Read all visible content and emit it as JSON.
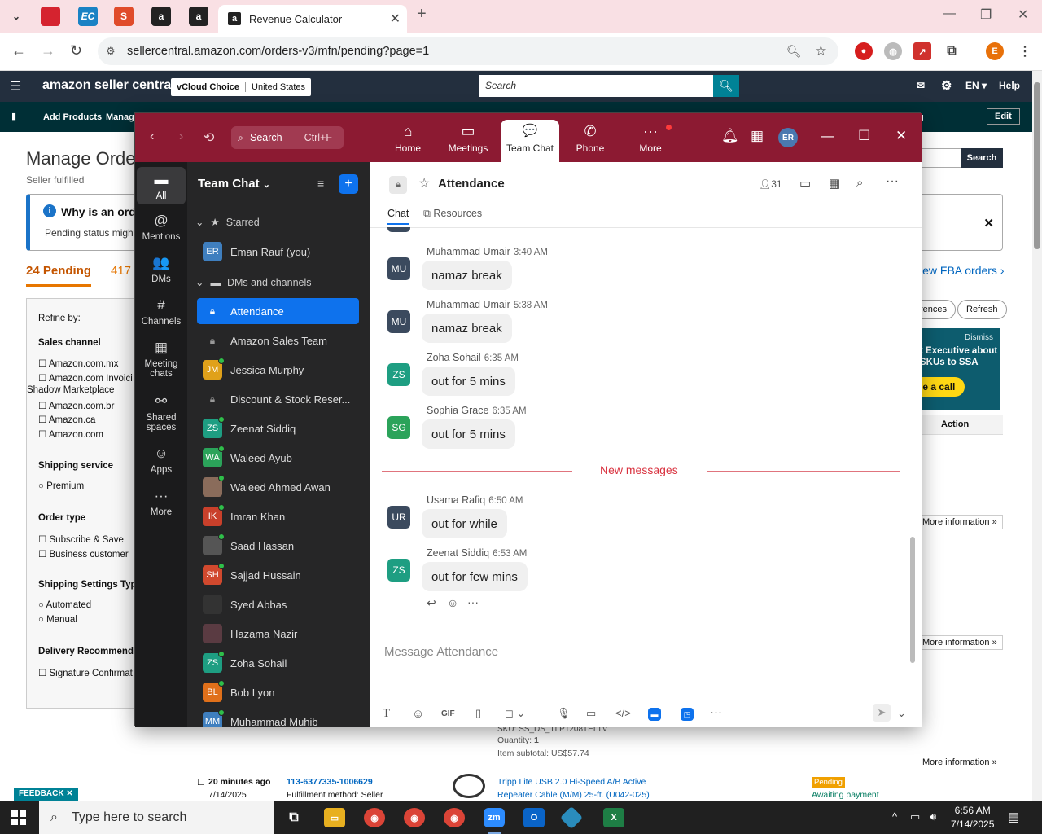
{
  "browser": {
    "tabs": [
      {
        "label": "",
        "icon": "red-app-icon",
        "color": "#d5232f"
      },
      {
        "label": "EC",
        "icon": "ec-icon",
        "color": "#1a82c4"
      },
      {
        "label": "S",
        "icon": "s-logo-icon",
        "color": "#e04b2a"
      },
      {
        "label": "a",
        "icon": "amazon-icon",
        "color": "#222222"
      },
      {
        "label": "a",
        "icon": "amazon-icon",
        "color": "#222222"
      }
    ],
    "active_tab_title": "Revenue Calculator",
    "active_tab_favicon": "a",
    "url": "sellercentral.amazon.com/orders-v3/mfn/pending?page=1",
    "profile_initial": "E"
  },
  "amazon": {
    "logo": "amazon seller central",
    "store_name": "vCloud Choice",
    "store_region": "United States",
    "search_placeholder": "Search",
    "lang": "EN",
    "help": "Help",
    "subnav": [
      "Add Products",
      "Manage"
    ],
    "edit": "Edit",
    "subnav_right_fragment": "g",
    "title": "Manage Orde",
    "subtitle": "Seller fulfilled",
    "info_title": "Why is an ord",
    "info_text": "Pending status might",
    "tab_pending": "24 Pending",
    "tab_other": "417",
    "view_fba": "iew FBA orders ›",
    "search_btn": "Search",
    "refine": {
      "label": "Refine by:",
      "sales_channel": "Sales channel",
      "channels": [
        "Amazon.com.mx",
        "Amazon.com Invoici",
        "Shadow Marketplace",
        "Amazon.com.br",
        "Amazon.ca",
        "Amazon.com"
      ],
      "shipping_service": "Shipping service",
      "premium": "Premium",
      "order_type": "Order type",
      "order_types": [
        "Subscribe & Save",
        "Business customer"
      ],
      "shipping_settings": "Shipping Settings Type",
      "settings": [
        "Automated",
        "Manual"
      ],
      "delivery": "Delivery Recommenda",
      "signature": "Signature Confirmat"
    },
    "right_panel": {
      "preferences": "rences",
      "refresh": "Refresh",
      "dismiss": "Dismiss",
      "promo_line1": "t Executive about",
      "promo_line2": "SKUs to SSA",
      "promo_btn": "le a call",
      "action_col": "Action",
      "more_info": "More information »"
    },
    "order_fragment": {
      "sku": "SKU: SS_DS_TLP1208TELTV",
      "quantity_label": "Quantity:",
      "quantity": "1",
      "subtotal_label": "Item subtotal:",
      "subtotal": "US$57.74",
      "time": "20 minutes ago",
      "date": "7/14/2025",
      "order_id": "113-6377335-1006629",
      "fulfillment": "Fulfillment method: Seller",
      "product_line1": "Tripp Lite USB 2.0 Hi-Speed A/B Active",
      "product_line2": "Repeater Cable (M/M) 25-ft. (U042-025)",
      "status_badge": "Pending",
      "status_text": "Awaiting payment"
    },
    "feedback": "FEEDBACK"
  },
  "zoom": {
    "search_label": "Search",
    "search_shortcut": "Ctrl+F",
    "tabs": [
      {
        "label": "Home",
        "icon": "⌂"
      },
      {
        "label": "Meetings",
        "icon": "▭"
      },
      {
        "label": "Team Chat",
        "icon": "💬"
      },
      {
        "label": "Phone",
        "icon": "✆"
      },
      {
        "label": "More",
        "icon": "···"
      }
    ],
    "user_initials": "ER",
    "rail": [
      {
        "label": "All",
        "icon": "▬"
      },
      {
        "label": "Mentions",
        "icon": "@"
      },
      {
        "label": "DMs",
        "icon": "👥"
      },
      {
        "label": "Channels",
        "icon": "#"
      },
      {
        "label": "Meeting chats",
        "icon": "▦"
      },
      {
        "label": "Shared spaces",
        "icon": "⚯"
      },
      {
        "label": "Apps",
        "icon": "☺"
      },
      {
        "label": "More",
        "icon": "···"
      }
    ],
    "list_title": "Team Chat",
    "starred_label": "Starred",
    "dms_label": "DMs and channels",
    "starred": [
      {
        "name": "Eman Rauf (you)",
        "initials": "ER",
        "color": "#3f7fbf"
      }
    ],
    "items": [
      {
        "name": "Attendance",
        "type": "lock",
        "active": true
      },
      {
        "name": "Amazon Sales Team",
        "type": "lock"
      },
      {
        "name": "Jessica Murphy",
        "initials": "JM",
        "color": "#e0a11a"
      },
      {
        "name": "Discount & Stock Reser...",
        "type": "lock"
      },
      {
        "name": "Zeenat Siddiq",
        "initials": "ZS",
        "color": "#1e9e82"
      },
      {
        "name": "Waleed Ayub",
        "initials": "WA",
        "color": "#2ba35a"
      },
      {
        "name": "Waleed Ahmed Awan",
        "initials": "",
        "color": "#8a6c5b"
      },
      {
        "name": "Imran Khan",
        "initials": "IK",
        "color": "#c9402b"
      },
      {
        "name": "Saad Hassan",
        "initials": "",
        "color": "#555555"
      },
      {
        "name": "Sajjad Hussain",
        "initials": "SH",
        "color": "#d1492e"
      },
      {
        "name": "Syed Abbas",
        "initials": "",
        "color": "#333333"
      },
      {
        "name": "Hazama Nazir",
        "initials": "",
        "color": "#5a3b42"
      },
      {
        "name": "Zoha Sohail",
        "initials": "ZS",
        "color": "#1e9e82"
      },
      {
        "name": "Bob Lyon",
        "initials": "BL",
        "color": "#e0701a"
      },
      {
        "name": "Muhammad Muhib",
        "initials": "MM",
        "color": "#3f7fbf"
      }
    ],
    "chat": {
      "title": "Attendance",
      "member_count": "31",
      "tab_chat": "Chat",
      "tab_resources": "Resources",
      "messages": [
        {
          "name": "Muhammad Umair",
          "time": "3:40 AM",
          "text": "namaz break",
          "initials": "MU",
          "color": "#3b4a5e"
        },
        {
          "name": "Muhammad Umair",
          "time": "5:38 AM",
          "text": "namaz break",
          "initials": "MU",
          "color": "#3b4a5e"
        },
        {
          "name": "Zoha Sohail",
          "time": "6:35 AM",
          "text": "out for 5 mins",
          "initials": "ZS",
          "color": "#1e9e82"
        },
        {
          "name": "Sophia Grace",
          "time": "6:35 AM",
          "text": "out for 5 mins",
          "initials": "SG",
          "color": "#2ba35a"
        },
        {
          "name": "Usama Rafiq",
          "time": "6:50 AM",
          "text": "out for while",
          "initials": "UR",
          "color": "#3b4a5e"
        },
        {
          "name": "Zeenat Siddiq",
          "time": "6:53 AM",
          "text": "out for few mins",
          "initials": "ZS",
          "color": "#1e9e82"
        }
      ],
      "new_messages": "New messages",
      "composer_placeholder": "Message Attendance"
    }
  },
  "taskbar": {
    "search_placeholder": "Type here to search",
    "time": "6:56 AM",
    "date": "7/14/2025"
  }
}
